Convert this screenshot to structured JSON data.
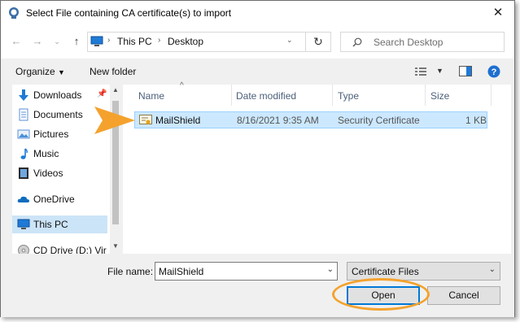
{
  "title": "Select File containing CA certificate(s) to import",
  "address": {
    "segments": [
      "This PC",
      "Desktop"
    ]
  },
  "search": {
    "placeholder": "Search Desktop"
  },
  "toolbar": {
    "organize_label": "Organize",
    "new_folder_label": "New folder"
  },
  "sidebar": {
    "items": [
      {
        "label": "Downloads",
        "icon": "download-icon"
      },
      {
        "label": "Documents",
        "icon": "documents-icon"
      },
      {
        "label": "Pictures",
        "icon": "pictures-icon"
      },
      {
        "label": "Music",
        "icon": "music-icon"
      },
      {
        "label": "Videos",
        "icon": "videos-icon"
      },
      {
        "label": "OneDrive",
        "icon": "cloud-icon"
      },
      {
        "label": "This PC",
        "icon": "computer-icon",
        "selected": true
      },
      {
        "label": "CD Drive (D:) Vir",
        "icon": "cd-drive-icon"
      }
    ]
  },
  "columns": [
    "Name",
    "Date modified",
    "Type",
    "Size"
  ],
  "files": [
    {
      "name": "MailShield",
      "date": "8/16/2021 9:35 AM",
      "type": "Security Certificate",
      "size": "1 KB",
      "selected": true
    }
  ],
  "file_name": {
    "label": "File name:",
    "value": "MailShield"
  },
  "file_type": {
    "value": "Certificate Files"
  },
  "buttons": {
    "open": "Open",
    "cancel": "Cancel"
  },
  "colors": {
    "accent": "#0078d7",
    "selection": "#cce8ff",
    "highlight": "#f4a22d"
  }
}
